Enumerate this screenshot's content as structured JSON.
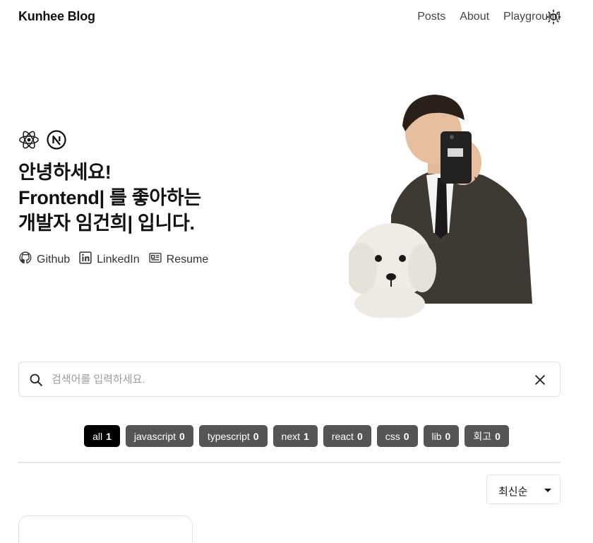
{
  "header": {
    "brand": "Kunhee Blog",
    "nav": [
      {
        "label": "Posts"
      },
      {
        "label": "About"
      },
      {
        "label": "Playground"
      }
    ],
    "theme_icon": "sun-icon"
  },
  "hero": {
    "tech_icons": [
      "react-icon",
      "nextjs-icon"
    ],
    "line1": "안녕하세요!",
    "line2_bold": "Frontend|",
    "line2_rest": " 를 좋아하는",
    "line3_pre": "개발자 ",
    "line3_bold": "임건희|",
    "line3_post": " 입니다.",
    "links": [
      {
        "label": "Github",
        "icon": "github-icon"
      },
      {
        "label": "LinkedIn",
        "icon": "linkedin-icon"
      },
      {
        "label": "Resume",
        "icon": "resume-icon"
      }
    ]
  },
  "search": {
    "placeholder": "검색어를 입력하세요.",
    "value": ""
  },
  "tags": [
    {
      "name": "all",
      "count": "1",
      "active": true
    },
    {
      "name": "javascript",
      "count": "0"
    },
    {
      "name": "typescript",
      "count": "0"
    },
    {
      "name": "next",
      "count": "1"
    },
    {
      "name": "react",
      "count": "0"
    },
    {
      "name": "css",
      "count": "0"
    },
    {
      "name": "lib",
      "count": "0"
    },
    {
      "name": "회고",
      "count": "0"
    }
  ],
  "sort": {
    "selected": "최신순"
  }
}
